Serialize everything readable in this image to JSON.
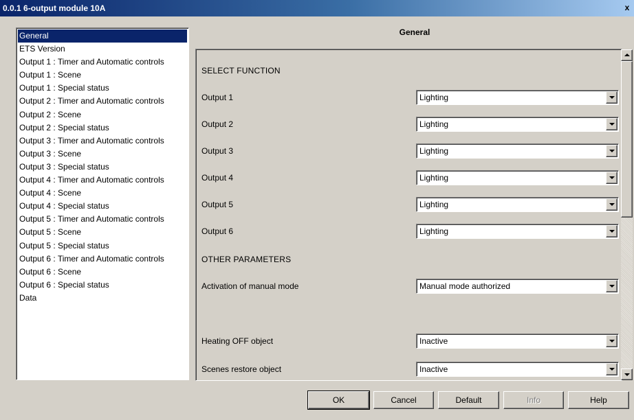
{
  "window": {
    "title": "0.0.1 6-output module 10A",
    "close_label": "x"
  },
  "nav": {
    "items": [
      "General",
      "ETS Version",
      "Output 1 : Timer and Automatic controls",
      "Output 1 : Scene",
      "Output 1 : Special status",
      "Output 2 : Timer and Automatic controls",
      "Output 2 : Scene",
      "Output 2 : Special status",
      "Output 3 : Timer and Automatic controls",
      "Output 3 : Scene",
      "Output 3 : Special status",
      "Output 4 : Timer and Automatic controls",
      "Output 4 : Scene",
      "Output 4 : Special status",
      "Output 5 : Timer and Automatic controls",
      "Output 5 : Scene",
      "Output 5 : Special status",
      "Output 6 : Timer and Automatic controls",
      "Output 6 : Scene",
      "Output 6 : Special status",
      "Data"
    ],
    "selected_index": 0
  },
  "panel": {
    "title": "General",
    "section_select": "SELECT FUNCTION",
    "section_other": "OTHER PARAMETERS",
    "outputs": [
      {
        "label": "Output 1",
        "value": "Lighting"
      },
      {
        "label": "Output 2",
        "value": "Lighting"
      },
      {
        "label": "Output 3",
        "value": "Lighting"
      },
      {
        "label": "Output 4",
        "value": "Lighting"
      },
      {
        "label": "Output 5",
        "value": "Lighting"
      },
      {
        "label": "Output 6",
        "value": "Lighting"
      }
    ],
    "manual_mode": {
      "label": "Activation of manual mode",
      "value": "Manual mode authorized"
    },
    "heating_off": {
      "label": "Heating OFF object",
      "value": "Inactive"
    },
    "scenes_restore": {
      "label": "Scenes restore object",
      "value": "Inactive"
    }
  },
  "buttons": {
    "ok": "OK",
    "cancel": "Cancel",
    "default": "Default",
    "info": "Info",
    "help": "Help"
  }
}
